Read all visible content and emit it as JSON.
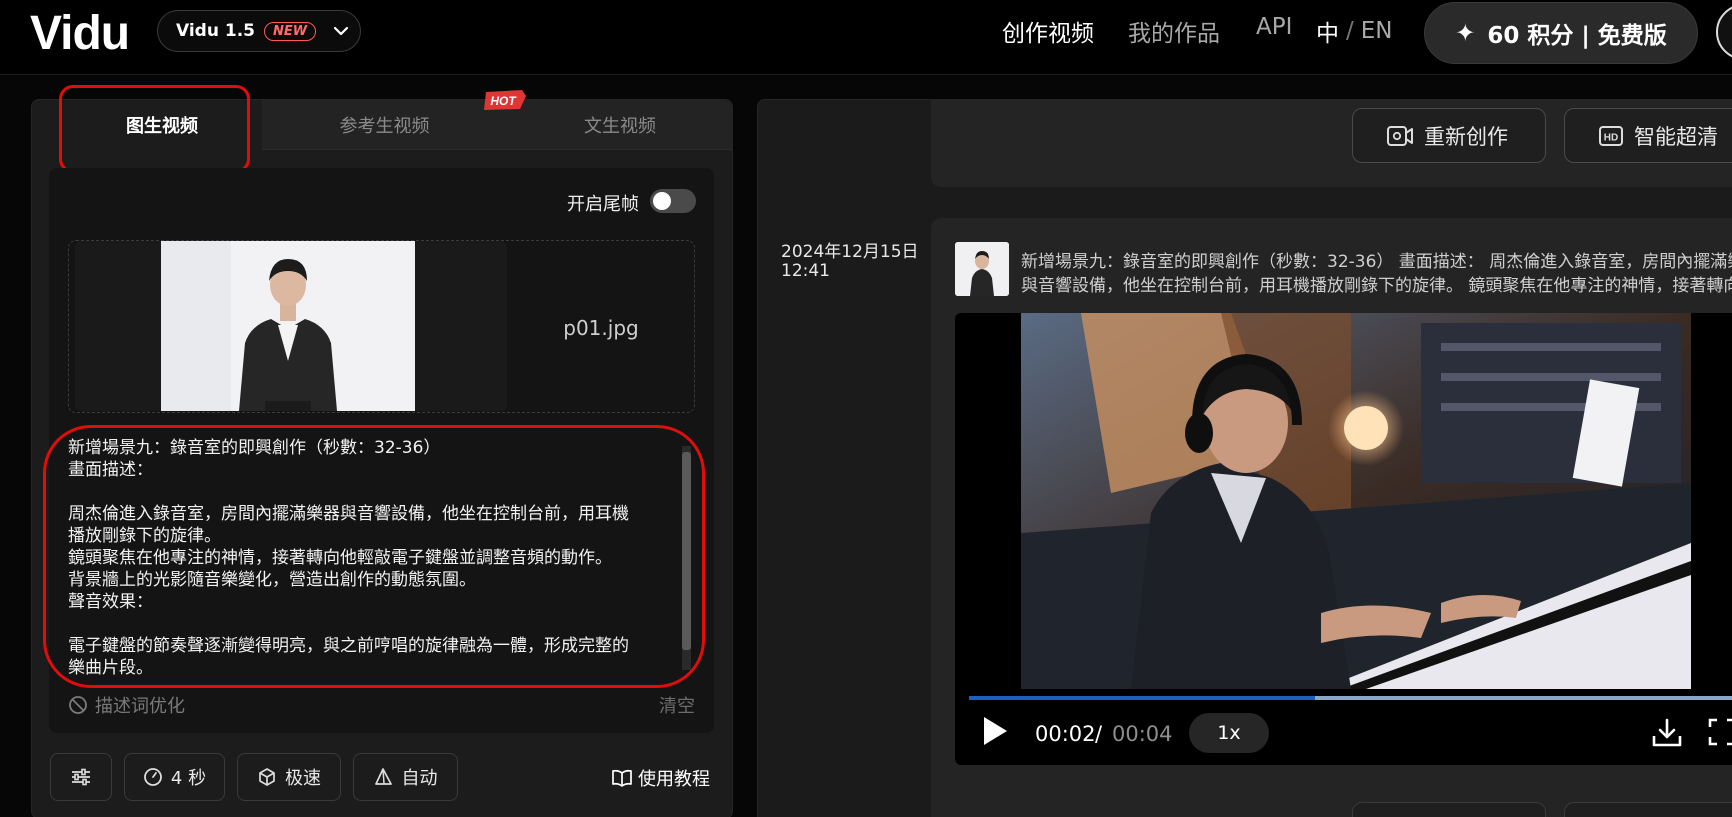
{
  "header": {
    "logo": "Vidu",
    "model": {
      "name": "Vidu 1.5",
      "badge": "NEW"
    },
    "nav": {
      "create": "创作视频",
      "works": "我的作品",
      "api": "API",
      "lang_zh": "中",
      "lang_sep": "/",
      "lang_en": "EN"
    },
    "credits": {
      "icon": "sparkle-icon",
      "text": "60 积分 | 免费版"
    }
  },
  "left": {
    "tabs": [
      {
        "label": "图生视频",
        "active": true
      },
      {
        "label": "参考生视频",
        "badge": "HOT"
      },
      {
        "label": "文生视频"
      }
    ],
    "tail_frame_label": "开启尾帧",
    "tail_frame_on": false,
    "upload": {
      "filename": "p01.jpg"
    },
    "prompt_lines": [
      "新增場景九：錄音室的即興創作（秒數：32-36）",
      "畫面描述：",
      "",
      "周杰倫進入錄音室，房間內擺滿樂器與音響設備，他坐在控制台前，用耳機",
      "播放剛錄下的旋律。",
      "鏡頭聚焦在他專注的神情，接著轉向他輕敲電子鍵盤並調整音頻的動作。",
      "背景牆上的光影隨音樂變化，營造出創作的動態氛圍。",
      "聲音效果：",
      "",
      "電子鍵盤的節奏聲逐漸變得明亮，與之前哼唱的旋律融為一體，形成完整的",
      "樂曲片段。"
    ],
    "optimize_label": "描述词优化",
    "clear_label": "清空",
    "toolbar": {
      "duration": "4 秒",
      "speed": "极速",
      "mode": "自动",
      "tutorial": "使用教程"
    }
  },
  "right": {
    "actions": {
      "recreate": "重新创作",
      "hd": "智能超清"
    },
    "timestamp": {
      "date": "2024年12月15日",
      "time": "12:41"
    },
    "prompt_preview": [
      "新增場景九：錄音室的即興創作（秒數：32-36） 畫面描述： 周杰倫進入錄音室，房間內擺滿樂器",
      "與音響設備，他坐在控制台前，用耳機播放剛錄下的旋律。 鏡頭聚焦在他專注的神情，接著轉向他輕敲"
    ],
    "player": {
      "current": "00:02",
      "separator": "/",
      "total": "00:04",
      "speed": "1x",
      "progress": 0.44
    }
  },
  "colors": {
    "highlight": "#e00d0d",
    "progress": "#1d5fbf",
    "hot": "#e03535"
  }
}
